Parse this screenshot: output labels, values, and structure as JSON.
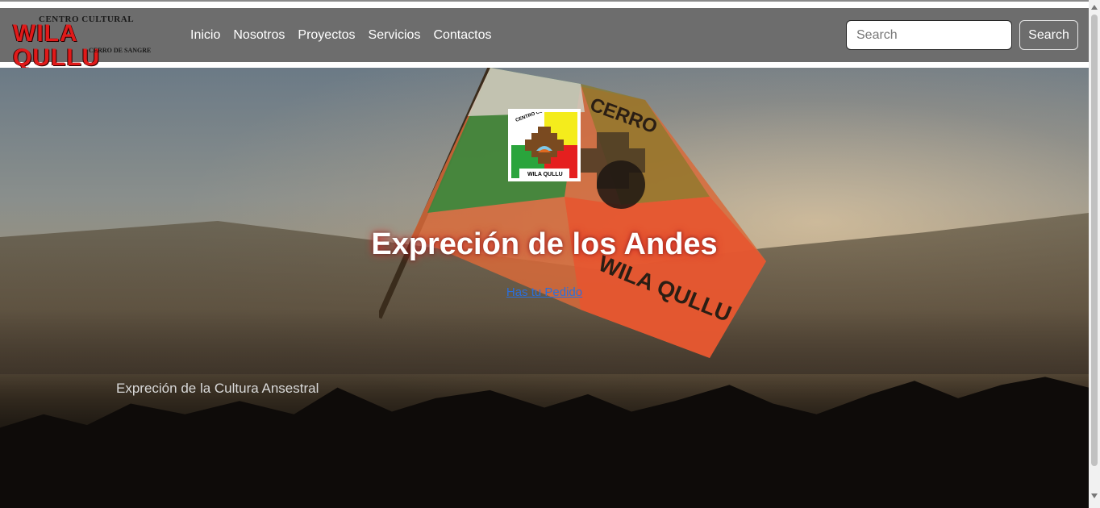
{
  "brand": {
    "top_text": "CENTRO CULTURAL",
    "name": "WILA QULLU",
    "bottom_text": "CERRO DE SANGRE"
  },
  "nav": {
    "items": [
      {
        "label": "Inicio"
      },
      {
        "label": "Nosotros"
      },
      {
        "label": "Proyectos"
      },
      {
        "label": "Servicios"
      },
      {
        "label": "Contactos"
      }
    ]
  },
  "search": {
    "placeholder": "Search",
    "button_label": "Search"
  },
  "hero": {
    "title": "Expreción de los Andes",
    "link_text": "Has tu Pedido",
    "caption": "Expreción de la Cultura Ansestral",
    "logo_top_text": "CENTRO CULTURAL",
    "logo_bottom_text": "WILA QULLU",
    "flag_text_1": "CERRO",
    "flag_text_2": "WILA QULLU"
  },
  "colors": {
    "navbar": "#6d6d6d",
    "brand_red": "#e01a1a",
    "link_blue": "#2b6fdc"
  }
}
